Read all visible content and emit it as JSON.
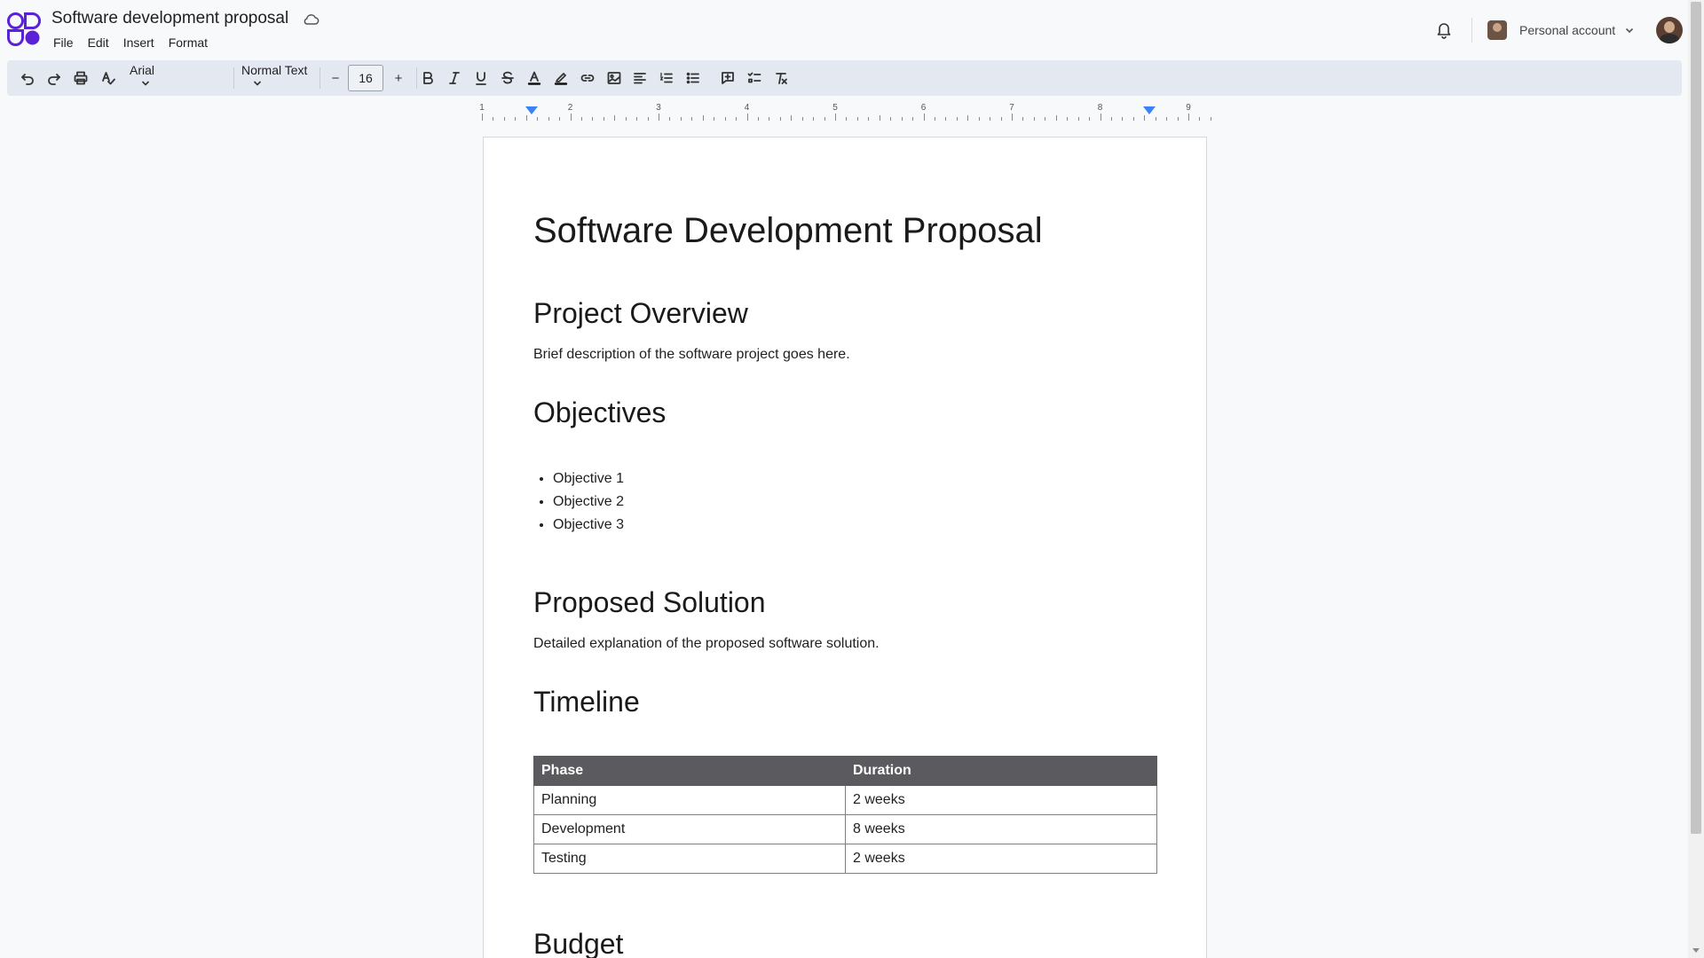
{
  "header": {
    "doc_title": "Software development proposal",
    "menu": [
      "File",
      "Edit",
      "Insert",
      "Format"
    ],
    "account_label": "Personal account"
  },
  "toolbar": {
    "font_family": "Arial",
    "text_style": "Normal Text",
    "font_size": "16",
    "decrease_label": "−",
    "increase_label": "+",
    "buttons": [
      "undo-icon",
      "redo-icon",
      "print-icon",
      "spellcheck-icon",
      "bold-icon",
      "italic-icon",
      "underline-icon",
      "strikethrough-icon",
      "text-color-icon",
      "highlight-icon",
      "link-icon",
      "image-icon",
      "align-icon",
      "numbered-list-icon",
      "bulleted-list-icon",
      "comment-icon",
      "checklist-icon",
      "clear-format-icon"
    ]
  },
  "ruler": {
    "numbers": [
      "1",
      "2",
      "3",
      "4",
      "5",
      "6",
      "7",
      "8",
      "9"
    ]
  },
  "document": {
    "title": "Software Development Proposal",
    "sections": {
      "overview": {
        "heading": "Project Overview",
        "body": "Brief description of the software project goes here."
      },
      "objectives": {
        "heading": "Objectives",
        "items": [
          "Objective 1",
          "Objective 2",
          "Objective 3"
        ]
      },
      "solution": {
        "heading": "Proposed Solution",
        "body": "Detailed explanation of the proposed software solution."
      },
      "timeline": {
        "heading": "Timeline",
        "columns": [
          "Phase",
          "Duration"
        ],
        "rows": [
          [
            "Planning",
            "2 weeks"
          ],
          [
            "Development",
            "8 weeks"
          ],
          [
            "Testing",
            "2 weeks"
          ]
        ]
      },
      "budget": {
        "heading": "Budget"
      }
    }
  },
  "colors": {
    "toolbar_bg": "#e3e8f1",
    "table_header_bg": "#5b5a5f",
    "ruler_marker": "#3b82f6",
    "logo": "#5b21d6"
  }
}
